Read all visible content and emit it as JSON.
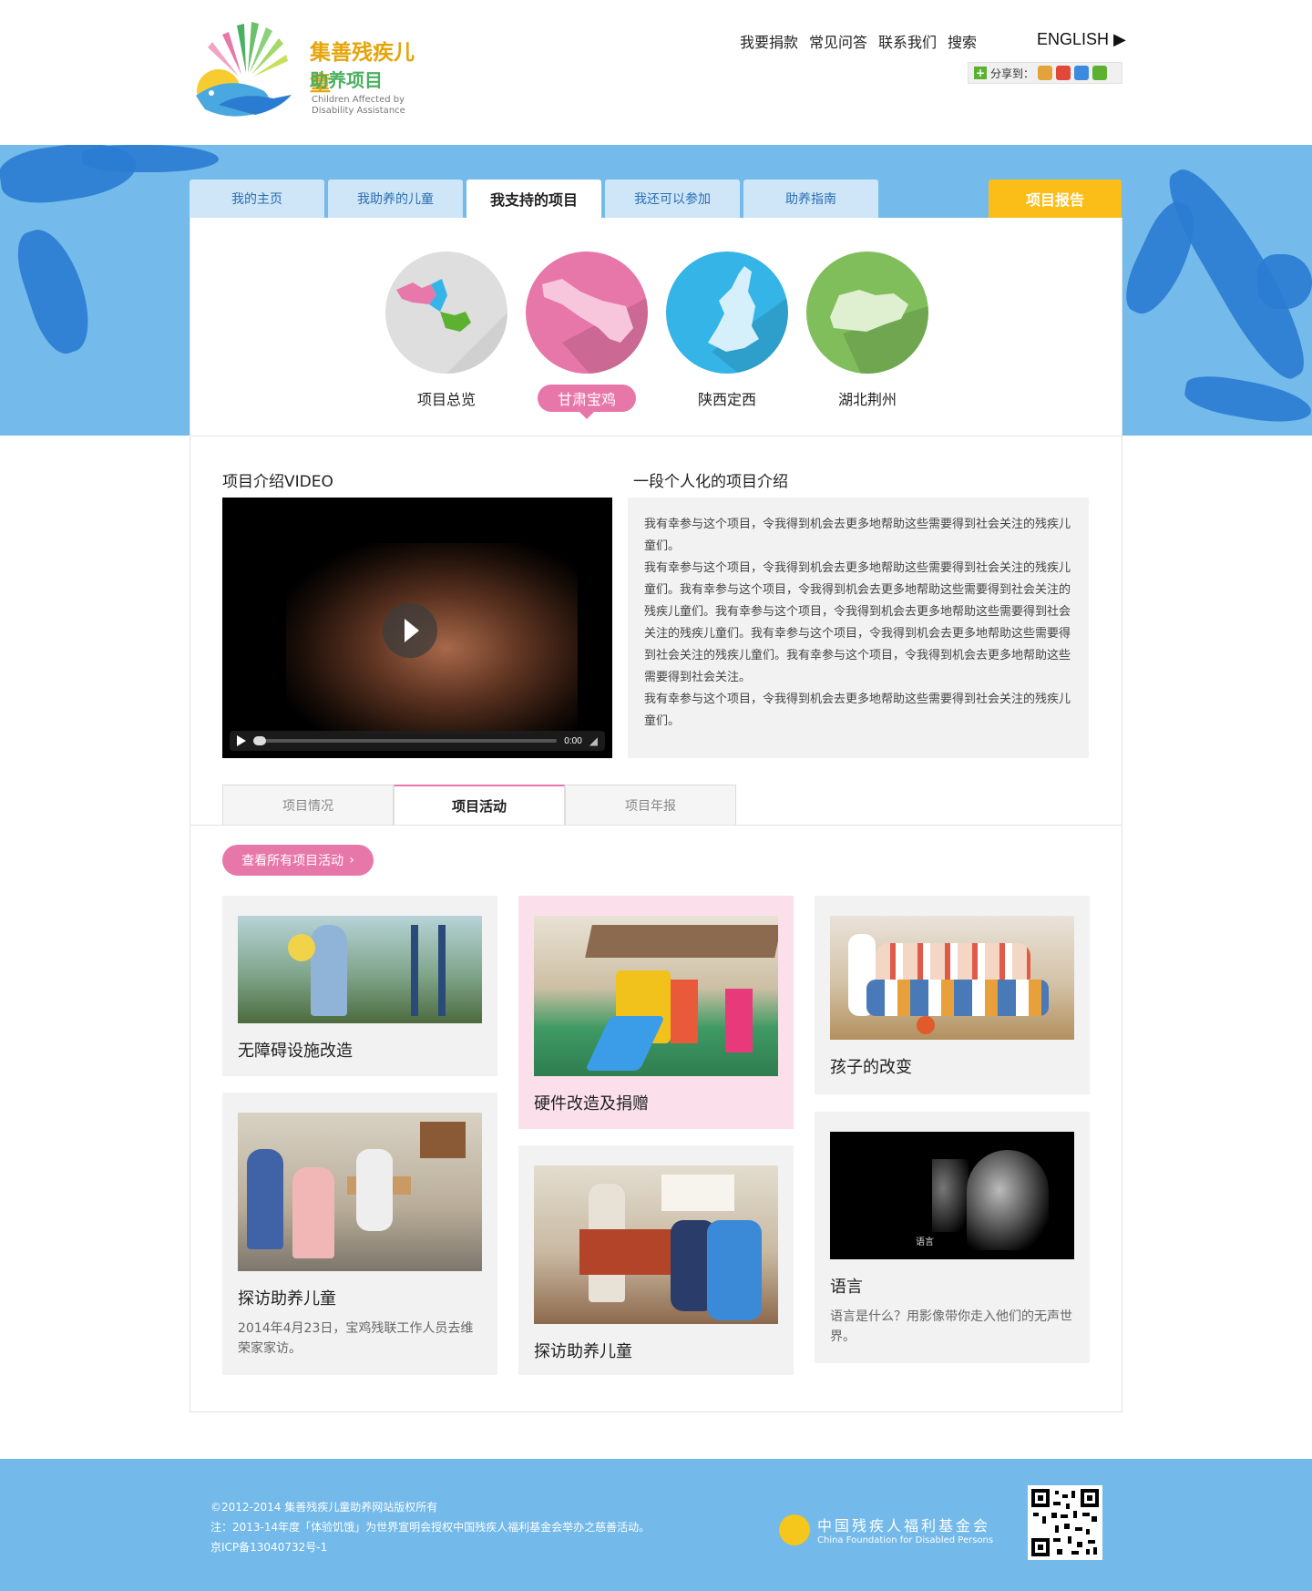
{
  "header": {
    "logo_cn_line1": "集善残疾儿童",
    "logo_cn_line2": "助养项目",
    "logo_en": "Children Affected by Disability Assistance",
    "nav": [
      "我要捐款",
      "常见问答",
      "联系我们",
      "搜索"
    ],
    "english_link": "ENGLISH",
    "share_label": "分享到："
  },
  "tabs": {
    "items": [
      "我的主页",
      "我助养的儿童",
      "我支持的项目",
      "我还可以参加",
      "助养指南"
    ],
    "active_index": 2,
    "report_button": "项目报告"
  },
  "regions": {
    "items": [
      "项目总览",
      "甘肃宝鸡",
      "陕西定西",
      "湖北荆州"
    ],
    "selected_index": 1,
    "colors": [
      "#dedede",
      "#e877a9",
      "#35b4e8",
      "#7fbe5a"
    ]
  },
  "video_section": {
    "title": "项目介绍VIDEO",
    "time": "0:00"
  },
  "intro_section": {
    "title": "一段个人化的项目介绍",
    "paragraphs": [
      "我有幸参与这个项目，令我得到机会去更多地帮助这些需要得到社会关注的残疾儿童们。",
      "我有幸参与这个项目，令我得到机会去更多地帮助这些需要得到社会关注的残疾儿童们。我有幸参与这个项目，令我得到机会去更多地帮助这些需要得到社会关注的残疾儿童们。我有幸参与这个项目，令我得到机会去更多地帮助这些需要得到社会关注的残疾儿童们。我有幸参与这个项目，令我得到机会去更多地帮助这些需要得到社会关注的残疾儿童们。我有幸参与这个项目，令我得到机会去更多地帮助这些需要得到社会关注。",
      "我有幸参与这个项目，令我得到机会去更多地帮助这些需要得到社会关注的残疾儿童们。"
    ]
  },
  "subtabs": {
    "items": [
      "项目情况",
      "项目活动",
      "项目年报"
    ],
    "active_index": 1
  },
  "activities": {
    "all_button": "查看所有项目活动",
    "cards": [
      {
        "title": "无障碍设施改造",
        "desc": ""
      },
      {
        "title": "硬件改造及捐赠",
        "desc": ""
      },
      {
        "title": "孩子的改变",
        "desc": ""
      },
      {
        "title": "探访助养儿童",
        "desc": "2014年4月23日，宝鸡残联工作人员去维荣家家访。"
      },
      {
        "title": "探访助养儿童",
        "desc": ""
      },
      {
        "title": "语言",
        "desc": "语言是什么？用影像带你走入他们的无声世界。",
        "image_caption": "语言"
      }
    ]
  },
  "footer": {
    "lines": [
      "©2012-2014 集善残疾儿童助养网站版权所有",
      "注：2013-14年度「体验饥饿」为世界宣明会授权中国残疾人福利基金会举办之慈善活动。",
      "京ICP备13040732号-1"
    ],
    "org_cn": "中国残疾人福利基金会",
    "org_en": "China Foundation for Disabled Persons"
  }
}
